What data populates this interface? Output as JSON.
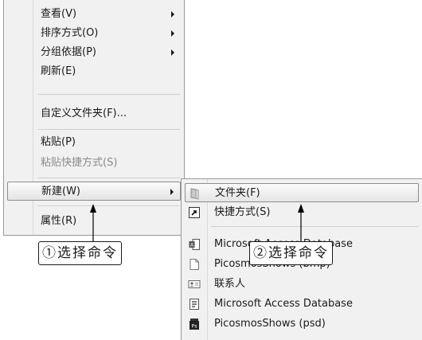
{
  "context_menu": {
    "items": [
      {
        "label": "查看(V)"
      },
      {
        "label": "排序方式(O)"
      },
      {
        "label": "分组依据(P)"
      },
      {
        "label": "刷新(E)"
      },
      {
        "label": "自定义文件夹(F)..."
      },
      {
        "label": "粘贴(P)"
      },
      {
        "label": "粘贴快捷方式(S)",
        "disabled": true
      },
      {
        "label": "新建(W)",
        "highlighted": true
      },
      {
        "label": "属性(R)"
      }
    ]
  },
  "submenu": {
    "items": [
      {
        "label": "文件夹(F)",
        "icon": "folder-icon",
        "highlighted": true
      },
      {
        "label": "快捷方式(S)",
        "icon": "shortcut-icon"
      },
      {
        "label": "Microsoft Access Database",
        "icon": "access-database-icon"
      },
      {
        "label": "PicosmosShows (bmp)",
        "icon": "blank-document-icon"
      },
      {
        "label": "联系人",
        "icon": "contact-card-icon"
      },
      {
        "label": "Microsoft Access Database",
        "icon": "access-database-icon"
      },
      {
        "label": "PicosmosShows (psd)",
        "icon": "psd-document-icon"
      }
    ]
  },
  "annotations": {
    "callout_1": "①选择命令",
    "callout_2": "②选择命令"
  },
  "colors": {
    "menu_background": "#f1f1f1",
    "menu_border": "#9a9a9a",
    "highlight_border": "#8d8d8d",
    "disabled_text": "#8a8a8a"
  }
}
